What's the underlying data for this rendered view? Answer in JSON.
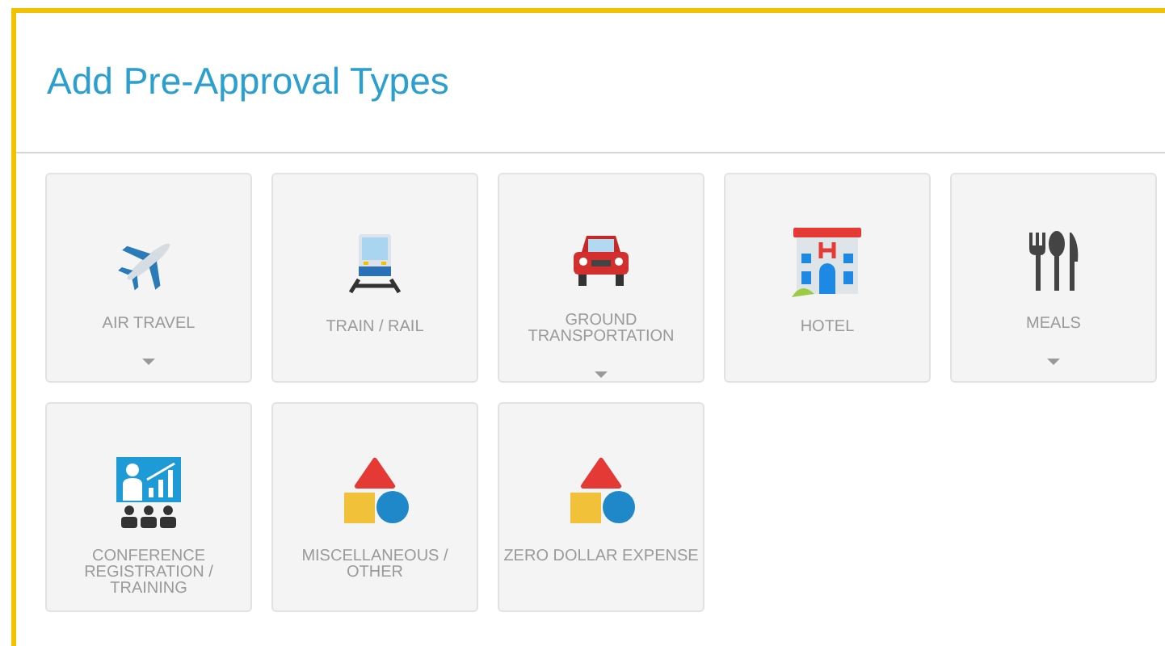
{
  "title": "Add Pre-Approval Types",
  "tiles": [
    {
      "kind": "plane",
      "label": "AIR TRAVEL",
      "has_menu": true
    },
    {
      "kind": "train",
      "label": "TRAIN / RAIL",
      "has_menu": false
    },
    {
      "kind": "car",
      "label": "GROUND TRANSPORTATION",
      "has_menu": true
    },
    {
      "kind": "hotel",
      "label": "HOTEL",
      "has_menu": false
    },
    {
      "kind": "meals",
      "label": "MEALS",
      "has_menu": true
    },
    {
      "kind": "conference",
      "label": "CONFERENCE REGISTRATION / TRAINING",
      "has_menu": false
    },
    {
      "kind": "shapes",
      "label": "MISCELLANEOUS / OTHER",
      "has_menu": false
    },
    {
      "kind": "shapes",
      "label": "ZERO DOLLAR EXPENSE",
      "has_menu": false
    }
  ]
}
